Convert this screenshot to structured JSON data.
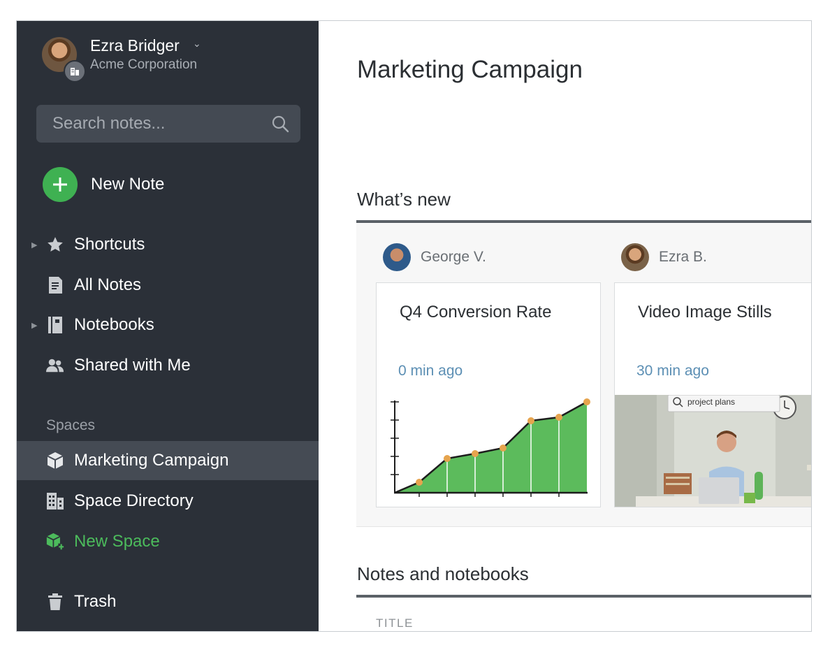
{
  "user": {
    "name": "Ezra Bridger",
    "org": "Acme Corporation"
  },
  "search": {
    "placeholder": "Search notes..."
  },
  "new_note": {
    "label": "New Note"
  },
  "nav": [
    {
      "label": "Shortcuts",
      "icon": "star-icon",
      "expandable": true
    },
    {
      "label": "All Notes",
      "icon": "note-icon",
      "expandable": false
    },
    {
      "label": "Notebooks",
      "icon": "notebook-icon",
      "expandable": true
    },
    {
      "label": "Shared with Me",
      "icon": "people-icon",
      "expandable": false
    }
  ],
  "spaces": {
    "header": "Spaces",
    "items": [
      {
        "label": "Marketing Campaign",
        "icon": "cube-icon",
        "active": true
      },
      {
        "label": "Space Directory",
        "icon": "building-icon",
        "active": false
      },
      {
        "label": "New Space",
        "icon": "new-space-icon",
        "active": false
      }
    ]
  },
  "trash": {
    "label": "Trash"
  },
  "main": {
    "title": "Marketing Campaign",
    "whats_new": {
      "title": "What’s new",
      "cards": [
        {
          "author": "George V.",
          "title": "Q4 Conversion Rate",
          "time": "0 min ago"
        },
        {
          "author": "Ezra B.",
          "title": "Video Image Stills",
          "time": "30 min ago",
          "image_search_text": "project plans"
        }
      ]
    },
    "notes_section": {
      "title": "Notes and notebooks",
      "column_header": "TITLE"
    }
  },
  "colors": {
    "sidebar_bg": "#2b3038",
    "accent_green": "#3fb152",
    "link_blue": "#5c8fb4"
  }
}
